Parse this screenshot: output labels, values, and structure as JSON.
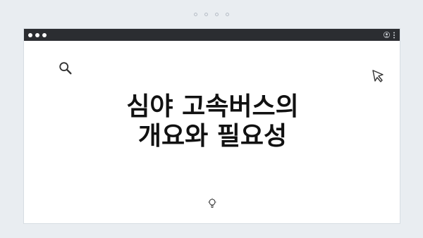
{
  "window": {
    "traffic_lights": [
      "close",
      "minimize",
      "maximize"
    ],
    "title_icons": [
      "user-icon",
      "more-vertical-icon"
    ]
  },
  "content": {
    "headline_line1": "심야 고속버스의",
    "headline_line2": "개요와 필요성"
  },
  "icons": {
    "top_left": "search-icon",
    "top_right": "cursor-arrow-icon",
    "bottom_center": "lightbulb-icon"
  },
  "colors": {
    "page_background": "#e9edf1",
    "titlebar": "#2b2d31",
    "card": "#ffffff",
    "text": "#111111"
  }
}
